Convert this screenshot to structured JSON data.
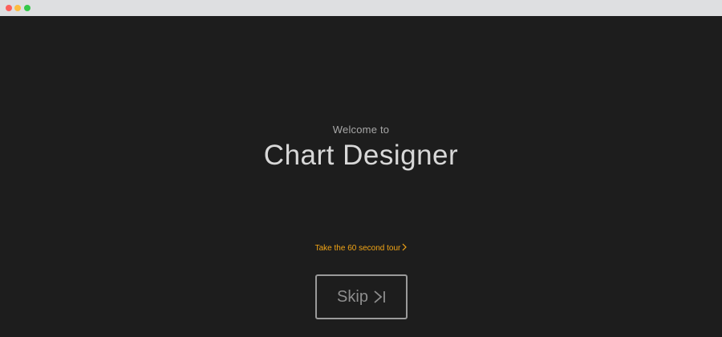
{
  "window": {
    "title": ""
  },
  "welcome": {
    "greeting": "Welcome to",
    "app_name": "Chart Designer"
  },
  "tour": {
    "link_label": "Take the 60 second tour",
    "icon": "chevron-right-icon"
  },
  "skip": {
    "label": "Skip",
    "icon": "skip-to-end-icon"
  },
  "colors": {
    "background": "#1d1d1d",
    "accent": "#f2a516",
    "title_text": "#d8d8d8",
    "muted_text": "#a8a8a8",
    "button_border": "#9a9a9a"
  }
}
